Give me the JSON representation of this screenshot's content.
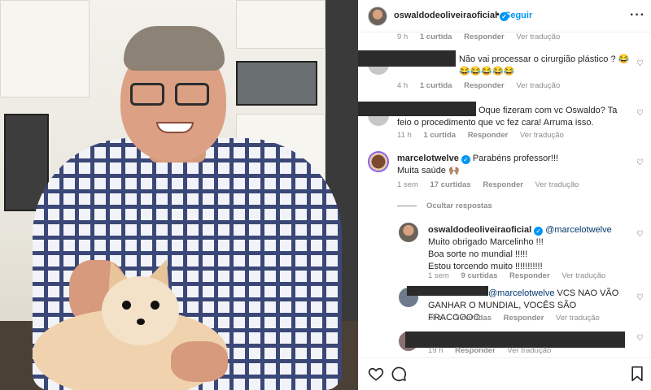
{
  "header": {
    "username": "oswaldodeoliveiraoficial",
    "follow_label": "Seguir",
    "separator": "•",
    "more_icon": "more-horizontal-icon"
  },
  "comments": [
    {
      "meta": {
        "time": "9 h",
        "likes": "1 curtida",
        "reply": "Responder",
        "translate": "Ver tradução"
      }
    },
    {
      "text": "Não vai processar o cirurgião plástico ? 😂😂😂😂😂😂",
      "meta": {
        "time": "4 h",
        "likes": "1 curtida",
        "reply": "Responder",
        "translate": "Ver tradução"
      }
    },
    {
      "text": "Oque fizeram com vc Oswaldo? Ta feio o procedimento que vc fez cara! Arruma isso.",
      "meta": {
        "time": "11 h",
        "likes": "1 curtida",
        "reply": "Responder",
        "translate": "Ver tradução"
      }
    },
    {
      "username": "marcelotwelve",
      "text": "Parabéns professor!!!",
      "text2": "Muita saúde 🙌🏽",
      "meta": {
        "time": "1 sem",
        "likes": "17 curtidas",
        "reply": "Responder",
        "translate": "Ver tradução"
      }
    }
  ],
  "hide_replies_label": "Ocultar respostas",
  "replies": [
    {
      "username": "oswaldodeoliveiraoficial",
      "mention": "@marcelotwelve",
      "lines": [
        "Muito obrigado Marcelinho !!!",
        "Boa sorte no mundial !!!!!",
        "Estou torcendo muito !!!!!!!!!!!"
      ],
      "meta": {
        "time": "1 sem",
        "likes": "9 curtidas",
        "reply": "Responder",
        "translate": "Ver tradução"
      }
    },
    {
      "mention": "@marcelotwelve",
      "text": "VCS NAO VÃO GANHAR O MUNDIAL, VOCÊS SÃO FRACOOOO",
      "meta": {
        "time": "20 h",
        "likes": "2 curtidas",
        "reply": "Responder",
        "translate": "Ver tradução"
      }
    },
    {
      "meta": {
        "time": "19 h",
        "reply": "Responder",
        "translate": "Ver tradução"
      }
    }
  ],
  "footer_icons": [
    "heart-icon",
    "comment-icon",
    "bookmark-icon"
  ],
  "colors": {
    "accent": "#0095f6",
    "muted": "#8e8e8e",
    "text": "#262626"
  }
}
